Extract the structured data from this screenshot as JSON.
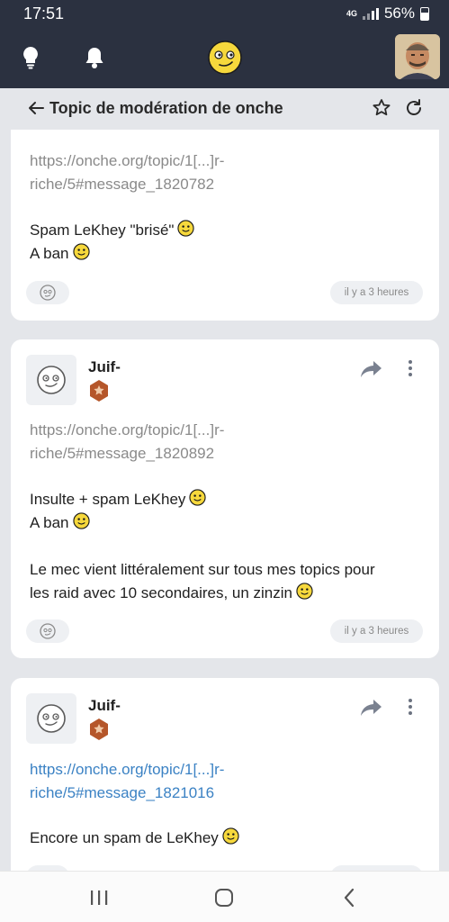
{
  "status": {
    "time": "17:51",
    "network": "4G",
    "battery": "56%"
  },
  "topic": {
    "title": "Topic de modération de onche"
  },
  "posts": [
    {
      "author": "",
      "link_line1": "https://onche.org/topic/1[...]r-",
      "link_line2": "riche/5#message_1820782",
      "lines": [
        "Spam LeKhey \"brisé\"",
        "A ban"
      ],
      "time": "il y a 3 heures"
    },
    {
      "author": "Juif-",
      "link_line1": "https://onche.org/topic/1[...]r-",
      "link_line2": "riche/5#message_1820892",
      "lines": [
        "Insulte + spam LeKhey",
        "A ban",
        "Le mec vient littéralement sur tous mes topics pour",
        "les raid avec 10 secondaires, un zinzin"
      ],
      "time": "il y a 3 heures"
    },
    {
      "author": "Juif-",
      "link_line1": "https://onche.org/topic/1[...]r-",
      "link_line2": "riche/5#message_1821016",
      "lines": [
        "Encore un spam de LeKhey"
      ],
      "time": ""
    }
  ],
  "colors": {
    "header": "#2b3140",
    "page_bg": "#e4e6ea",
    "link_blue": "#3b82c4",
    "badge": "#b5562a"
  }
}
